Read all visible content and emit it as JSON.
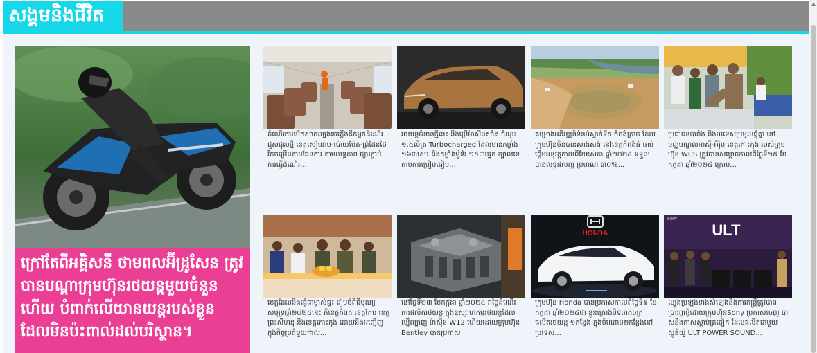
{
  "section": {
    "title": "សង្គមនិងជីវិត"
  },
  "feature": {
    "caption": "ក្រៅតែពីអគ្គិសនី ថាមពលអ៊ីដ្រូសែន ត្រូវបានបណ្តាក្រុមហ៊ុនរថយន្តមួយចំនួន ហើយ បំពាក់លើយានយន្តរបស់ខ្លួន ដែលមិនប៉ះពាល់ដល់បរិស្ថាន។",
    "image_label": "Kawasaki motorcycle rider"
  },
  "cards": [
    {
      "text": "ដំណើរការបើកសាកល្បងរថភ្លើងដឹកអ្នកដំណើរជួសជុលថ្មី ខេត្តសៀមរាប-ប៉ោយប៉ែត-ព្រំដែនថៃ រីកចម្រើនតាមផែនការ តាមលទ្ធភាព ផ្សារភ្ជាប់ការធ្វើដំណើរ...",
      "image_label": "Train interior"
    },
    {
      "text": "រថយន្តជំនាន់ថ្មីនេះ នឹងប្រើម៉ាស៊ីនសាំង ចំណុះ ១.៥លីត្រ Turbocharged ដែលមានកម្លាំង ១៦៣សេះ និងកម្លាំងម៉ូទ័រ ១៥៣ផ្ទេក ក្បាលទេ តាមការប្រៀបធៀប...",
      "image_label": "Bronze concept car"
    },
    {
      "text": "គម្រោងអភិវឌ្ឍន៍ទំនប់ស្ទាក់ទឹក កំពង់ត្រាច ដែលក្រុមហ៊ុនចិនបានសាងសង់ នៅខេត្តកំពង់ធំ ចាប់ផ្តើមអនុវត្តកាលពីខែឧសភា ឆ្នាំ២០២៤ ទទួលបានលទ្ធផលល្អ ប្រមាណ ៣០%...",
      "image_label": "Reservoir construction site"
    },
    {
      "text": "ប្រជាជនបារាំង និងបរទេសប្រមូលផ្តុំគ្នា នៅមជ្ឈមណ្ឌលអាស៊ី-អឺរ៉ុប ខេត្តកោះកុង របស់ក្រុមហ៊ុន WCS ត្រូវបានសម្ពោធកាលពីថ្ងៃទី១៥ ខែកក្កដា ឆ្នាំ២០២៤ ក្រោម...",
      "image_label": "Officials at event"
    },
    {
      "text": "ខេត្តដែលនឹងធ្វើជាម្ចាស់ផ្ទះ រៀបចំពិធីបុណ្យសមុទ្រឆ្នាំ២០២៤នេះ គឺខេត្តកំពត ខេត្តកែប ខេត្តព្រះសីហនុ និងខេត្តកោះកុង ដោយនឹងអញ្ជើញ ក្នុងកិច្ចប្រជុំមួយកាល...",
      "image_label": "Officials meeting at table"
    },
    {
      "text": "នៅថ្ងៃទី២៣ ខែកក្កដា ឆ្នាំ២០២៤ វាថ្ងៃដំណើរការផលិតរថយន្ត ក្នុងឧស្សាហកម្មរថយន្តដែលល្បីល្បាញ ម៉ាស៊ីន W12 ហើយដោយក្រុមហ៊ុន Bentley បានប្រកាស",
      "image_label": "W12 engine"
    },
    {
      "text": "ក្រុមហ៊ុន Honda បានប្រកាសកាលពីថ្ងៃទី៩ ខែកក្កដា ឆ្នាំ២០២៤ថា ខ្លួនគ្រោងបិទរោងចក្រផលិតរថយន្ត ១កន្លែង ក្នុងចំណោម២កន្លែងនៅប្រទេស...",
      "image_label": "Honda white SUV"
    },
    {
      "text": "ល្បួងប្រឡងខាងសំឡេងនិងការតន្ត្រីត្រូវបានប្រារព្ធធ្វើដោយក្រុមហ៊ុនSony ប្រកាសចេញ បាសនិងកាសស្តាប់ត្រចៀក ដែលផលិតជាមួយស្ទូឌីយ៉ូ ULT POWER SOUND...",
      "image_label": "Sony ULT event"
    }
  ],
  "logos": {
    "honda": "HONDA",
    "ult": "ULT",
    "sony": "SONY"
  },
  "colors": {
    "accent": "#16d8e8",
    "header_gray": "#8a8a8a",
    "feature_pink": "#ea3f95",
    "background": "#eef4fa"
  }
}
